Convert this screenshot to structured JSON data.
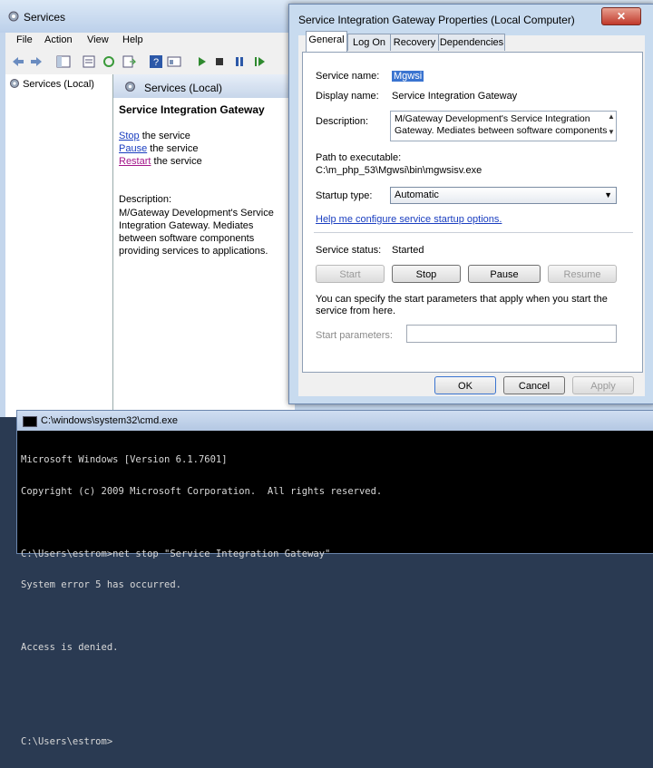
{
  "services_window": {
    "title": "Services",
    "menu": [
      "File",
      "Action",
      "View",
      "Help"
    ],
    "tree_item": "Services (Local)",
    "header_title": "Services (Local)",
    "selected_service_name": "Service Integration Gateway",
    "actions": [
      {
        "link": "Stop",
        "rest": " the service"
      },
      {
        "link": "Pause",
        "rest": " the service"
      },
      {
        "link": "Restart",
        "rest": " the service"
      }
    ],
    "description_label": "Description:",
    "description_lines": [
      "M/Gateway Development's Service",
      "Integration Gateway.  Mediates",
      "between software components",
      "providing services to applications."
    ]
  },
  "dialog": {
    "title": "Service Integration Gateway Properties (Local Computer)",
    "close_glyph": "✕",
    "tabs": [
      "General",
      "Log On",
      "Recovery",
      "Dependencies"
    ],
    "active_tab": "General",
    "service_name_label": "Service name:",
    "service_name_value": "Mgwsi",
    "display_name_label": "Display name:",
    "display_name_value": "Service Integration Gateway",
    "description_label": "Description:",
    "description_value": "M/Gateway Development's Service Integration Gateway.  Mediates between software components",
    "path_label": "Path to executable:",
    "path_value": "C:\\m_php_53\\Mgwsi\\bin\\mgwsisv.exe",
    "startup_type_label": "Startup type:",
    "startup_type_value": "Automatic",
    "help_link": "Help me configure service startup options.",
    "service_status_label": "Service status:",
    "service_status_value": "Started",
    "control_buttons": {
      "start": "Start",
      "stop": "Stop",
      "pause": "Pause",
      "resume": "Resume"
    },
    "params_hint": "You can specify the start parameters that apply when you start the service from here.",
    "start_params_label": "Start parameters:",
    "start_params_value": "",
    "footer_buttons": {
      "ok": "OK",
      "cancel": "Cancel",
      "apply": "Apply"
    }
  },
  "cmd_window": {
    "title": "C:\\windows\\system32\\cmd.exe",
    "lines": [
      "Microsoft Windows [Version 6.1.7601]",
      "Copyright (c) 2009 Microsoft Corporation.  All rights reserved.",
      "",
      "C:\\Users\\estrom>net stop \"Service Integration Gateway\"",
      "System error 5 has occurred.",
      "",
      "Access is denied.",
      "",
      "",
      "C:\\Users\\estrom>"
    ]
  },
  "colors": {
    "link": "#1a3ec0",
    "visited_link": "#a3168a",
    "selection": "#3a74d0",
    "console_bg": "#000000",
    "console_fg": "#d8d8d8"
  }
}
